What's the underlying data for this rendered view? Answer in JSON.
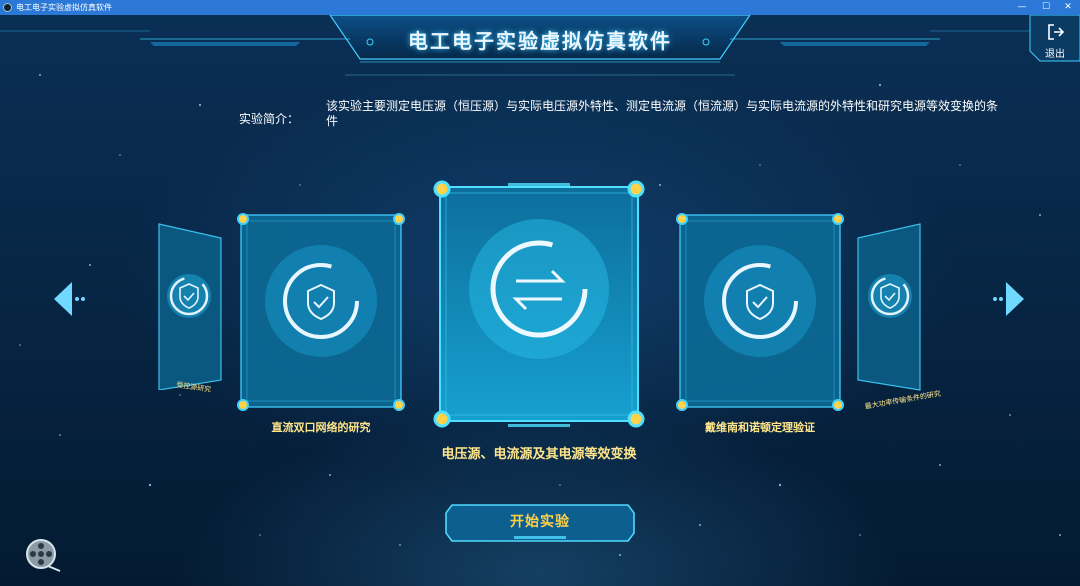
{
  "window": {
    "title": "电工电子实验虚拟仿真软件",
    "controls": {
      "minimize": "—",
      "maximize": "☐",
      "close": "✕"
    }
  },
  "header": {
    "title": "电工电子实验虚拟仿真软件",
    "exit_label": "退出"
  },
  "intro": {
    "label": "实验简介：",
    "text": "该实验主要测定电压源（恒压源）与实际电压源外特性、测定电流源（恒流源）与实际电流源的外特性和研究电源等效变换的条件"
  },
  "carousel": {
    "experiments": [
      {
        "label": "受控源研究",
        "icon": "shield-check-icon",
        "position": "far-left"
      },
      {
        "label": "直流双口网络的研究",
        "icon": "shield-check-icon",
        "position": "left"
      },
      {
        "label": "电压源、电流源及其电源等效变换",
        "icon": "swap-arrows-icon",
        "position": "center",
        "selected": true
      },
      {
        "label": "戴维南和诺顿定理验证",
        "icon": "shield-check-icon",
        "position": "right"
      },
      {
        "label": "最大功率传输条件的研究",
        "icon": "shield-check-icon",
        "position": "far-right"
      }
    ],
    "prev_icon": "chevron-left-icon",
    "next_icon": "chevron-right-icon"
  },
  "actions": {
    "start_label": "开始实验",
    "film_icon": "film-reel-icon"
  },
  "colors": {
    "accent": "#3fd0ff",
    "label": "#ffe68a",
    "start_text": "#ffd04a",
    "titlebar": "#2b78d6"
  }
}
